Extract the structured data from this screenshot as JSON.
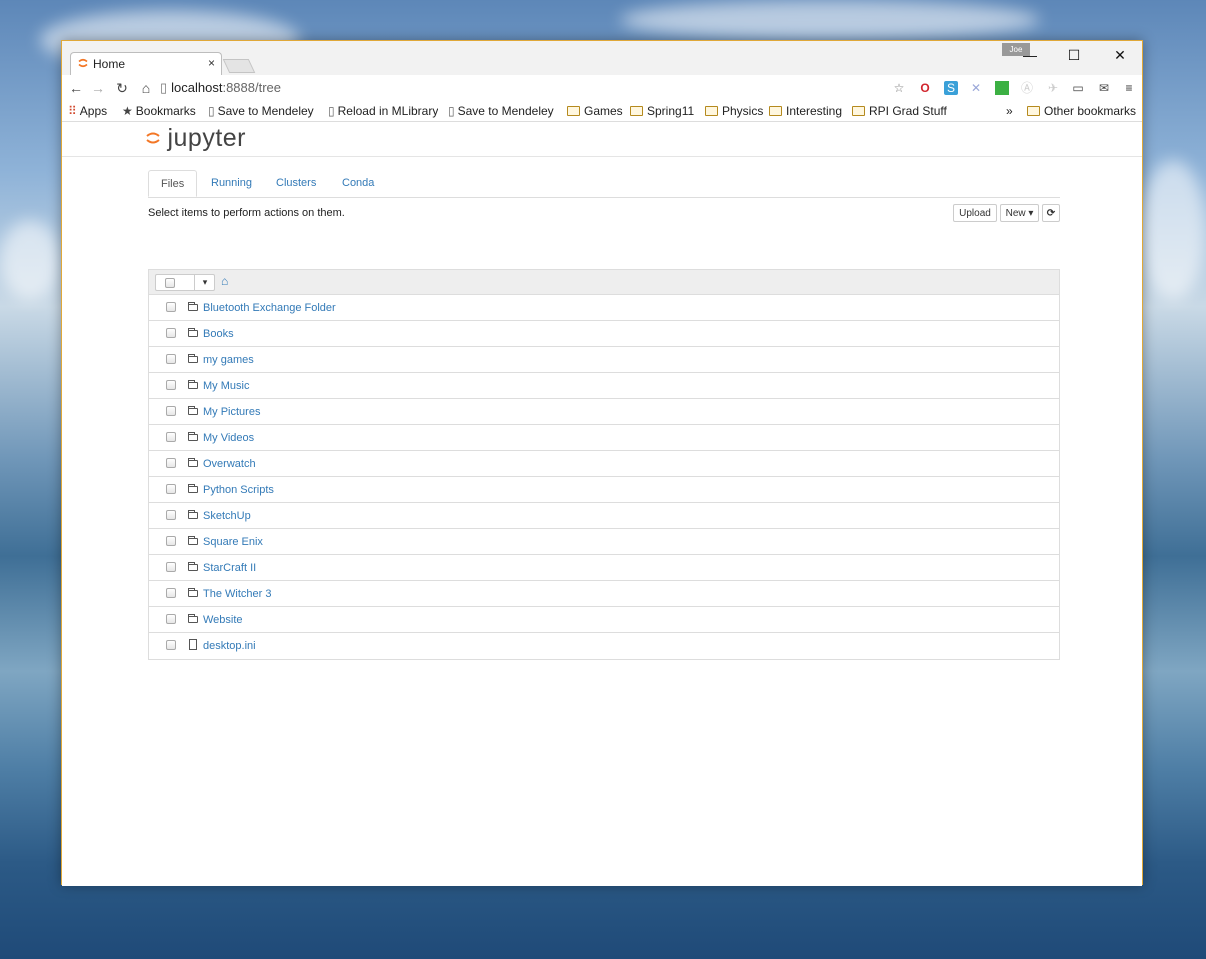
{
  "browser": {
    "tab_title": "Home",
    "tab_close": "×",
    "profile_name": "Joe",
    "url_host": "localhost",
    "url_rest": ":8888/tree",
    "window_controls": [
      "—",
      "☐",
      "✕"
    ]
  },
  "bookmarks": {
    "apps": "Apps",
    "bookmarks": "Bookmarks",
    "items": [
      "Save to Mendeley",
      "Reload in MLibrary",
      "Save to Mendeley"
    ],
    "folders": [
      "Games",
      "Spring11",
      "Physics",
      "Interesting",
      "RPI Grad Stuff"
    ],
    "overflow": "»",
    "other": "Other bookmarks"
  },
  "jupyter": {
    "logo_text": "jupyter",
    "tabs": [
      "Files",
      "Running",
      "Clusters",
      "Conda"
    ],
    "active_tab": "Files",
    "hint": "Select items to perform actions on them.",
    "upload_label": "Upload",
    "new_label": "New ▾",
    "refresh_icon": "⟳",
    "home_icon": "⌂",
    "dropdown_icon": "▾",
    "files": [
      {
        "name": "Bluetooth Exchange Folder",
        "type": "folder"
      },
      {
        "name": "Books",
        "type": "folder"
      },
      {
        "name": "my games",
        "type": "folder"
      },
      {
        "name": "My Music",
        "type": "folder"
      },
      {
        "name": "My Pictures",
        "type": "folder"
      },
      {
        "name": "My Videos",
        "type": "folder"
      },
      {
        "name": "Overwatch",
        "type": "folder"
      },
      {
        "name": "Python Scripts",
        "type": "folder"
      },
      {
        "name": "SketchUp",
        "type": "folder"
      },
      {
        "name": "Square Enix",
        "type": "folder"
      },
      {
        "name": "StarCraft II",
        "type": "folder"
      },
      {
        "name": "The Witcher 3",
        "type": "folder"
      },
      {
        "name": "Website",
        "type": "folder"
      },
      {
        "name": "desktop.ini",
        "type": "file"
      }
    ]
  },
  "colors": {
    "link": "#337ab7",
    "accent": "#f37726",
    "frame": "#e0a838"
  }
}
